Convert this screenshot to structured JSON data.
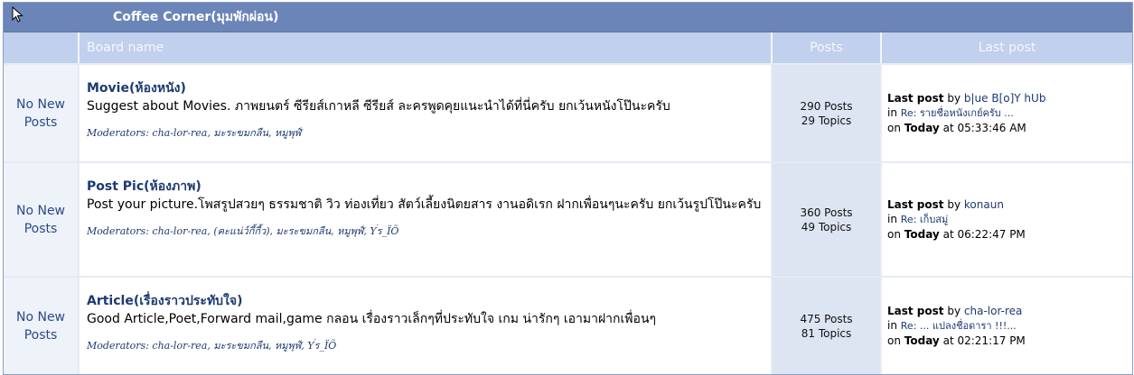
{
  "category": {
    "title": "Coffee Corner(มุมพักผ่อน)"
  },
  "header": {
    "icon_col": "",
    "board_name": "Board name",
    "posts": "Posts",
    "last_post": "Last post"
  },
  "labels": {
    "moderators": "Moderators:",
    "last_post": "Last post",
    "by": "by",
    "in": "in",
    "on": "on",
    "at": "at"
  },
  "boards": [
    {
      "status_line1": "No New",
      "status_line2": "Posts",
      "name": "Movie(ห้องหนัง)",
      "description": "Suggest about Movies. ภาพยนตร์ ซีรียส์เกาหลี ซีรียส์ ละครพูดคุยแนะนำได้ที่นี่ครับ ยกเว้นหนังโป๊นะครับ",
      "moderators": "cha-lor-rea, มะระขมกลืน, หมูพุฬ์",
      "posts": "290 Posts",
      "topics": "29 Topics",
      "last_by": "b|ue B[o]Y hUb",
      "last_in": "Re: รายชื่อหนังเกย์ครับ ...",
      "last_day": "Today",
      "last_time": "05:33:46 AM"
    },
    {
      "status_line1": "No New",
      "status_line2": "Posts",
      "name": "Post Pic(ห้องภาพ)",
      "description": "Post your picture.โพสรูปสวยๆ ธรรมชาติ วิว ท่องเที่ยว สัตว์เลี้ยงนิตยสาร งานอดิเรก ฝากเพื่อนๆนะครับ ยกเว้นรูปโป๊นะครับ",
      "moderators": "cha-lor-rea, (คะแน่ว์กี้กี้ว), มะระขมกลืน, หมูพุฬ์, Y่ร_ÏÕ",
      "posts": "360 Posts",
      "topics": "49 Topics",
      "last_by": "konaun",
      "last_in": "Re: เก็บสมู่",
      "last_day": "Today",
      "last_time": "06:22:47 PM"
    },
    {
      "status_line1": "No New",
      "status_line2": "Posts",
      "name": "Article(เรื่องราวประทับใจ)",
      "description": "Good Article,Poet,Forward mail,game กลอน เรื่องราวเล็กๆที่ประทับใจ เกม น่ารักๆ เอามาฝากเพื่อนๆ",
      "moderators": "cha-lor-rea, มะระขมกลืน, หมูพุฬ์, Y่ร_ÏÕ",
      "posts": "475 Posts",
      "topics": "81 Topics",
      "last_by": "cha-lor-rea",
      "last_in": "Re: ... แปลงชื่อดารา !!!...",
      "last_day": "Today",
      "last_time": "02:21:17 PM"
    }
  ],
  "colors": {
    "category_bar": "#6b85b9",
    "header_row": "#c1d0ec",
    "link": "#1c3a70"
  },
  "icons": {
    "pointer": "cursor-arrow-icon"
  }
}
